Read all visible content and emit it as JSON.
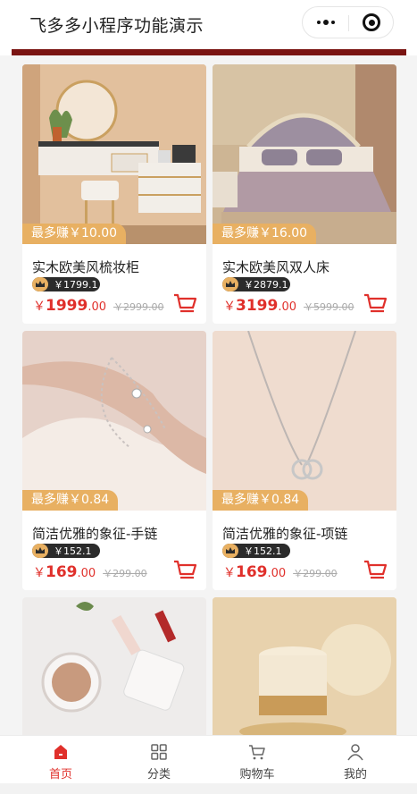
{
  "nav": {
    "title": "飞多多小程序功能演示",
    "more_icon": "more-dots-icon",
    "close_icon": "target-circle-icon"
  },
  "accent": "#e0302b",
  "earn_color": "#e8b062",
  "products": [
    {
      "title": "实木欧美风梳妆柜",
      "earn": "最多赚￥10.00",
      "vip_price": "￥1799.1",
      "currency": "￥",
      "price_int": "1999",
      "price_dec": ".00",
      "orig_price": "￥2999.00"
    },
    {
      "title": "实木欧美风双人床",
      "earn": "最多赚￥16.00",
      "vip_price": "￥2879.1",
      "currency": "￥",
      "price_int": "3199",
      "price_dec": ".00",
      "orig_price": "￥5999.00"
    },
    {
      "title": "简洁优雅的象征-手链",
      "earn": "最多赚￥0.84",
      "vip_price": "￥152.1",
      "currency": "￥",
      "price_int": "169",
      "price_dec": ".00",
      "orig_price": "￥299.00"
    },
    {
      "title": "简洁优雅的象征-项链",
      "earn": "最多赚￥0.84",
      "vip_price": "￥152.1",
      "currency": "￥",
      "price_int": "169",
      "price_dec": ".00",
      "orig_price": "￥299.00"
    },
    {
      "title": "",
      "earn": "",
      "vip_price": "",
      "currency": "",
      "price_int": "",
      "price_dec": "",
      "orig_price": ""
    },
    {
      "title": "",
      "earn": "",
      "vip_price": "",
      "currency": "",
      "price_int": "",
      "price_dec": "",
      "orig_price": ""
    }
  ],
  "tabbar": [
    {
      "label": "首页",
      "icon": "home-icon",
      "active": true
    },
    {
      "label": "分类",
      "icon": "grid-icon",
      "active": false
    },
    {
      "label": "购物车",
      "icon": "cart-icon",
      "active": false
    },
    {
      "label": "我的",
      "icon": "user-icon",
      "active": false
    }
  ]
}
